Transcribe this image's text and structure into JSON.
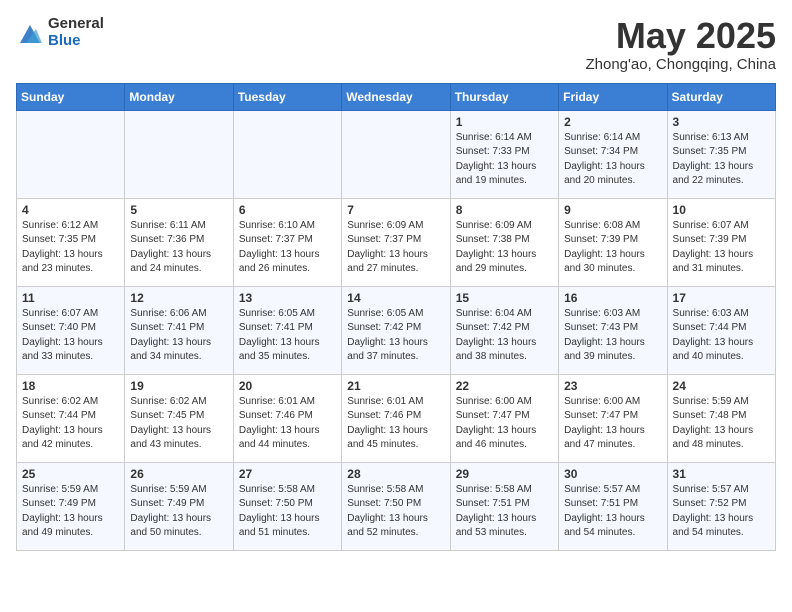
{
  "header": {
    "logo_general": "General",
    "logo_blue": "Blue",
    "month_title": "May 2025",
    "subtitle": "Zhong'ao, Chongqing, China"
  },
  "days_of_week": [
    "Sunday",
    "Monday",
    "Tuesday",
    "Wednesday",
    "Thursday",
    "Friday",
    "Saturday"
  ],
  "weeks": [
    [
      {
        "day": "",
        "info": ""
      },
      {
        "day": "",
        "info": ""
      },
      {
        "day": "",
        "info": ""
      },
      {
        "day": "",
        "info": ""
      },
      {
        "day": "1",
        "info": "Sunrise: 6:14 AM\nSunset: 7:33 PM\nDaylight: 13 hours\nand 19 minutes."
      },
      {
        "day": "2",
        "info": "Sunrise: 6:14 AM\nSunset: 7:34 PM\nDaylight: 13 hours\nand 20 minutes."
      },
      {
        "day": "3",
        "info": "Sunrise: 6:13 AM\nSunset: 7:35 PM\nDaylight: 13 hours\nand 22 minutes."
      }
    ],
    [
      {
        "day": "4",
        "info": "Sunrise: 6:12 AM\nSunset: 7:35 PM\nDaylight: 13 hours\nand 23 minutes."
      },
      {
        "day": "5",
        "info": "Sunrise: 6:11 AM\nSunset: 7:36 PM\nDaylight: 13 hours\nand 24 minutes."
      },
      {
        "day": "6",
        "info": "Sunrise: 6:10 AM\nSunset: 7:37 PM\nDaylight: 13 hours\nand 26 minutes."
      },
      {
        "day": "7",
        "info": "Sunrise: 6:09 AM\nSunset: 7:37 PM\nDaylight: 13 hours\nand 27 minutes."
      },
      {
        "day": "8",
        "info": "Sunrise: 6:09 AM\nSunset: 7:38 PM\nDaylight: 13 hours\nand 29 minutes."
      },
      {
        "day": "9",
        "info": "Sunrise: 6:08 AM\nSunset: 7:39 PM\nDaylight: 13 hours\nand 30 minutes."
      },
      {
        "day": "10",
        "info": "Sunrise: 6:07 AM\nSunset: 7:39 PM\nDaylight: 13 hours\nand 31 minutes."
      }
    ],
    [
      {
        "day": "11",
        "info": "Sunrise: 6:07 AM\nSunset: 7:40 PM\nDaylight: 13 hours\nand 33 minutes."
      },
      {
        "day": "12",
        "info": "Sunrise: 6:06 AM\nSunset: 7:41 PM\nDaylight: 13 hours\nand 34 minutes."
      },
      {
        "day": "13",
        "info": "Sunrise: 6:05 AM\nSunset: 7:41 PM\nDaylight: 13 hours\nand 35 minutes."
      },
      {
        "day": "14",
        "info": "Sunrise: 6:05 AM\nSunset: 7:42 PM\nDaylight: 13 hours\nand 37 minutes."
      },
      {
        "day": "15",
        "info": "Sunrise: 6:04 AM\nSunset: 7:42 PM\nDaylight: 13 hours\nand 38 minutes."
      },
      {
        "day": "16",
        "info": "Sunrise: 6:03 AM\nSunset: 7:43 PM\nDaylight: 13 hours\nand 39 minutes."
      },
      {
        "day": "17",
        "info": "Sunrise: 6:03 AM\nSunset: 7:44 PM\nDaylight: 13 hours\nand 40 minutes."
      }
    ],
    [
      {
        "day": "18",
        "info": "Sunrise: 6:02 AM\nSunset: 7:44 PM\nDaylight: 13 hours\nand 42 minutes."
      },
      {
        "day": "19",
        "info": "Sunrise: 6:02 AM\nSunset: 7:45 PM\nDaylight: 13 hours\nand 43 minutes."
      },
      {
        "day": "20",
        "info": "Sunrise: 6:01 AM\nSunset: 7:46 PM\nDaylight: 13 hours\nand 44 minutes."
      },
      {
        "day": "21",
        "info": "Sunrise: 6:01 AM\nSunset: 7:46 PM\nDaylight: 13 hours\nand 45 minutes."
      },
      {
        "day": "22",
        "info": "Sunrise: 6:00 AM\nSunset: 7:47 PM\nDaylight: 13 hours\nand 46 minutes."
      },
      {
        "day": "23",
        "info": "Sunrise: 6:00 AM\nSunset: 7:47 PM\nDaylight: 13 hours\nand 47 minutes."
      },
      {
        "day": "24",
        "info": "Sunrise: 5:59 AM\nSunset: 7:48 PM\nDaylight: 13 hours\nand 48 minutes."
      }
    ],
    [
      {
        "day": "25",
        "info": "Sunrise: 5:59 AM\nSunset: 7:49 PM\nDaylight: 13 hours\nand 49 minutes."
      },
      {
        "day": "26",
        "info": "Sunrise: 5:59 AM\nSunset: 7:49 PM\nDaylight: 13 hours\nand 50 minutes."
      },
      {
        "day": "27",
        "info": "Sunrise: 5:58 AM\nSunset: 7:50 PM\nDaylight: 13 hours\nand 51 minutes."
      },
      {
        "day": "28",
        "info": "Sunrise: 5:58 AM\nSunset: 7:50 PM\nDaylight: 13 hours\nand 52 minutes."
      },
      {
        "day": "29",
        "info": "Sunrise: 5:58 AM\nSunset: 7:51 PM\nDaylight: 13 hours\nand 53 minutes."
      },
      {
        "day": "30",
        "info": "Sunrise: 5:57 AM\nSunset: 7:51 PM\nDaylight: 13 hours\nand 54 minutes."
      },
      {
        "day": "31",
        "info": "Sunrise: 5:57 AM\nSunset: 7:52 PM\nDaylight: 13 hours\nand 54 minutes."
      }
    ]
  ]
}
